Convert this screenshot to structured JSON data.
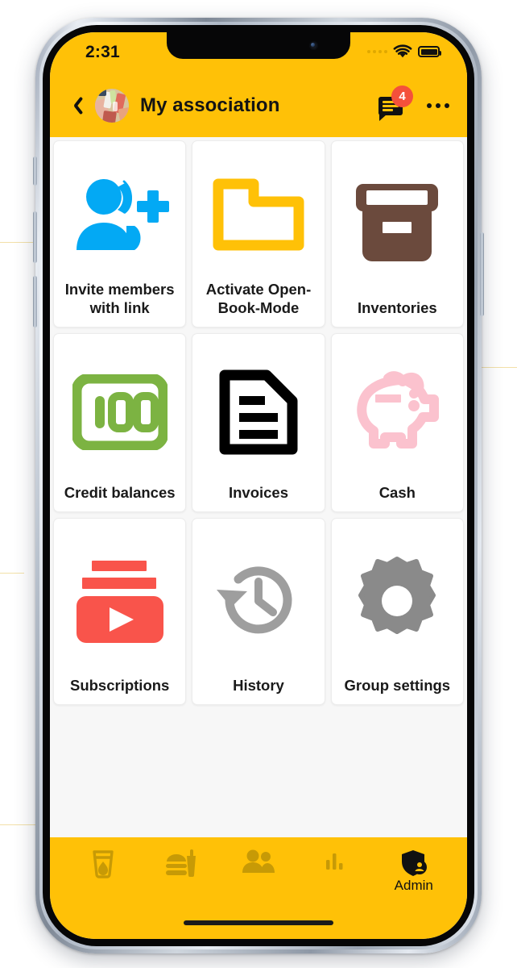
{
  "status_bar": {
    "time": "2:31",
    "signal_icon": "signal-dots-icon",
    "wifi_icon": "wifi-icon",
    "battery_icon": "battery-full-icon"
  },
  "app_bar": {
    "back_icon": "back-chevron-icon",
    "avatar_icon": "group-avatar-photo",
    "title": "My association",
    "chat_icon": "chat-bubble-icon",
    "chat_badge_count": "4",
    "more_icon": "more-options-icon"
  },
  "grid": {
    "tiles": [
      {
        "label": "Invite members with link",
        "icon": "person-add-icon",
        "color": "#03A9F4"
      },
      {
        "label": "Activate Open-Book-Mode",
        "icon": "folder-open-icon",
        "color": "#FFC107"
      },
      {
        "label": "Inventories",
        "icon": "archive-box-icon",
        "color": "#6B4A3D"
      },
      {
        "label": "Credit balances",
        "icon": "banknote-100-icon",
        "color": "#7CB342"
      },
      {
        "label": "Invoices",
        "icon": "document-lines-icon",
        "color": "#000000"
      },
      {
        "label": "Cash",
        "icon": "piggy-bank-icon",
        "color": "#FBC2CE"
      },
      {
        "label": "Subscriptions",
        "icon": "subscriptions-play-icon",
        "color": "#F9544B"
      },
      {
        "label": "History",
        "icon": "history-clock-icon",
        "color": "#9E9E9E"
      },
      {
        "label": "Group settings",
        "icon": "gear-icon",
        "color": "#8A8A8A"
      }
    ]
  },
  "bottom_nav": {
    "items": [
      {
        "label": "",
        "icon": "drink-glass-icon",
        "active": false
      },
      {
        "label": "",
        "icon": "fast-food-icon",
        "active": false
      },
      {
        "label": "",
        "icon": "people-icon",
        "active": false
      },
      {
        "label": "",
        "icon": "bar-chart-icon",
        "active": false
      },
      {
        "label": "Admin",
        "icon": "admin-shield-icon",
        "active": true
      }
    ]
  },
  "colors": {
    "brand_yellow": "#FFC107",
    "badge_red": "#F4513B",
    "screen_bg": "#F7F7F7",
    "tile_bg": "#FFFFFF",
    "nav_inactive": "#C79A06",
    "nav_active": "#111111"
  }
}
